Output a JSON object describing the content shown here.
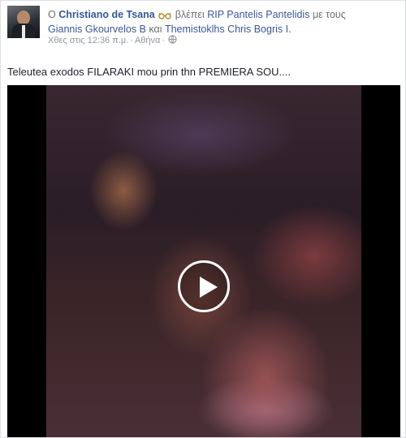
{
  "post": {
    "prefix": "Ο",
    "author": "Christiano de Tsana",
    "activity": "βλέπει",
    "watching": "RIP Pantelis Pantelidis",
    "with_word": "με τους",
    "tagged_1": "Giannis Gkourvelos B",
    "and_word": "και",
    "tagged_2": "Themistoklhs Chris Bogris I.",
    "time": "Χθες στις 12:36 π.μ.",
    "location": "Αθήνα",
    "message": "Teleutea exodos FILARAKI mou prin thn PREMIERA SOU....",
    "activity_icon": "glasses-icon",
    "privacy_icon": "globe-icon"
  },
  "colors": {
    "link": "#3b5998",
    "text": "#1d2129",
    "meta": "#90949c"
  }
}
